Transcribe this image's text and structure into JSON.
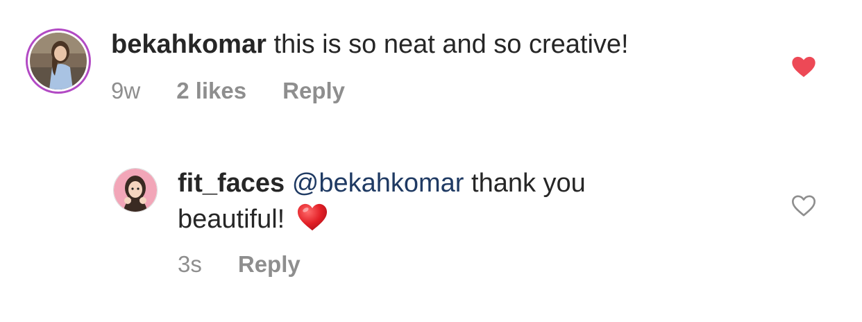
{
  "comments": [
    {
      "username": "bekahkomar",
      "text": " this is so neat and so creative!",
      "time": "9w",
      "likes": "2 likes",
      "reply_label": "Reply",
      "liked": true
    },
    {
      "username": "fit_faces",
      "mention": "@bekahkomar",
      "text_line1": " thank you",
      "text_line2": "beautiful!",
      "emoji": "red-heart",
      "time": "3s",
      "reply_label": "Reply",
      "liked": false
    }
  ],
  "colors": {
    "liked_heart": "#ed4956",
    "unliked_heart": "#8e8e8e",
    "mention": "#1f3a63",
    "meta_text": "#8e8e8e",
    "story_ring": "#c13584"
  }
}
